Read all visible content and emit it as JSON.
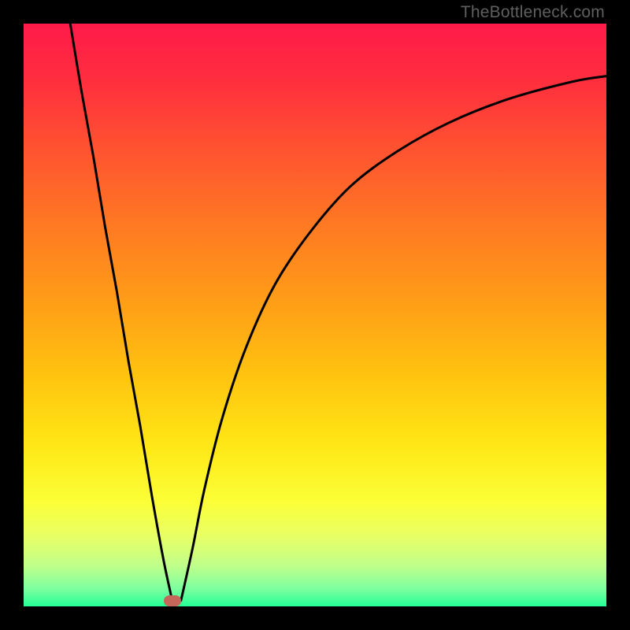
{
  "watermark_text": "TheBottleneck.com",
  "gradient": {
    "stops": [
      {
        "offset": 0.0,
        "color": "#ff1a49"
      },
      {
        "offset": 0.1,
        "color": "#ff2f3e"
      },
      {
        "offset": 0.22,
        "color": "#ff5430"
      },
      {
        "offset": 0.35,
        "color": "#ff7a22"
      },
      {
        "offset": 0.48,
        "color": "#ff9e17"
      },
      {
        "offset": 0.6,
        "color": "#ffc210"
      },
      {
        "offset": 0.72,
        "color": "#ffe615"
      },
      {
        "offset": 0.82,
        "color": "#fbff36"
      },
      {
        "offset": 0.88,
        "color": "#e8ff66"
      },
      {
        "offset": 0.93,
        "color": "#c0ff8a"
      },
      {
        "offset": 0.97,
        "color": "#7dffa0"
      },
      {
        "offset": 1.0,
        "color": "#23ff95"
      }
    ]
  },
  "chart_data": {
    "type": "line",
    "title": "",
    "xlabel": "",
    "ylabel": "",
    "xlim": [
      0,
      100
    ],
    "ylim": [
      0,
      100
    ],
    "grid": false,
    "legend": false,
    "series": [
      {
        "name": "curve-left",
        "x": [
          8,
          10,
          12,
          14,
          16,
          18,
          20,
          22,
          24,
          25.5
        ],
        "y": [
          100,
          88,
          77,
          65,
          54,
          42,
          31,
          19,
          8,
          1
        ]
      },
      {
        "name": "curve-right",
        "x": [
          27,
          29,
          31,
          34,
          38,
          43,
          49,
          56,
          64,
          73,
          83,
          94,
          100
        ],
        "y": [
          1,
          10,
          20,
          32,
          44,
          55,
          64,
          72,
          78,
          83,
          87,
          90,
          91
        ]
      }
    ],
    "marker": {
      "x": 25.5,
      "y": 1,
      "color": "#c46659"
    }
  }
}
